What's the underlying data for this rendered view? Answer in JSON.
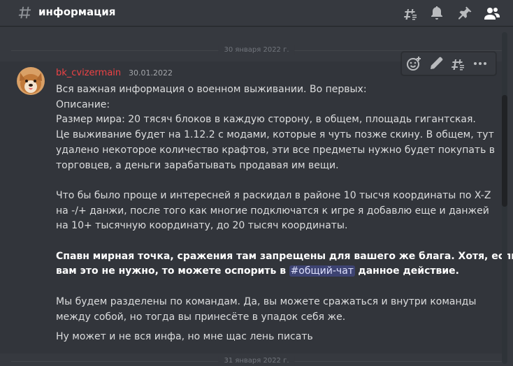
{
  "header": {
    "channel_name": "информация"
  },
  "date_dividers": [
    "30 января 2022 г.",
    "31 января 2022 г."
  ],
  "message": {
    "author": "bk_cvizermain",
    "timestamp": "30.01.2022",
    "author_color": "#ed4245",
    "lines": {
      "l1": "Вся важная информация о военном выживании. Во первых:",
      "l2": "Описание:",
      "l3": "Размер мира: 20 тясяч блоков в каждую сторону, в общем, площадь гигантская.",
      "l4": "Це выживание будет на 1.12.2 с модами, которые я чуть позже скину. В общем, тут",
      "l5": "удалено некоторое количество крафтов, эти все предметы нужно будет покупать в",
      "l6": "торговцев, а деньги зарабатывать продавая им вещи.",
      "l7": "Что бы было проще и интересней я раскидал в районе 10 тысчя координаты  по X-Z",
      "l8": "на -/+ данжи, после того как многие подключатся к игре я добавлю еще и данжей",
      "l9": "на 10+ тысячную координату, до 20 тысяч координаты.",
      "bold1": "Спавн мирная точка, сражения там запрещены для вашего же блага. Хотя, если",
      "bold2a": "вам это не нужно, то можете оспорить в",
      "mention": "общий-чат",
      "bold2b": "данное действие.",
      "l10": "Мы будем разделены по командам. Да, вы можете сражаться и внутри команды",
      "l11": "между собой, но тогда вы принесёте в упадок себя же."
    },
    "followup": "Ну может и не вся инфа, но мне щас лень писать"
  },
  "colors": {
    "background": "#36393f",
    "hovered_message": "#32353b",
    "mention_bg": "#4752c4"
  }
}
